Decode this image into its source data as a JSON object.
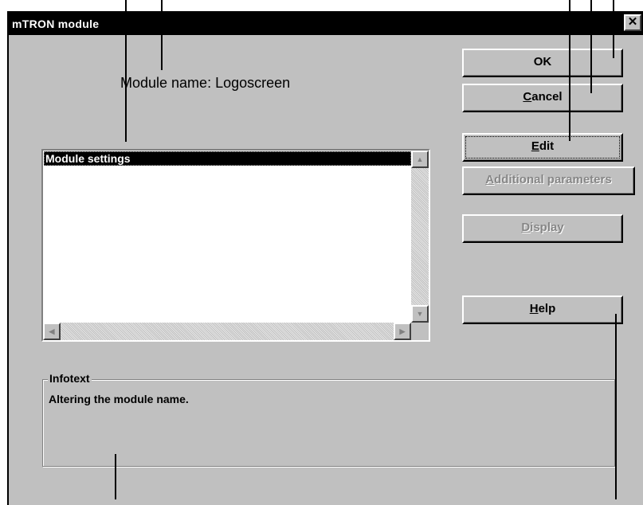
{
  "window": {
    "title": "mTRON module",
    "close_glyph": "✕"
  },
  "module_name": "Module name: Logoscreen",
  "buttons": {
    "ok": "OK",
    "cancel_mnemonic": "C",
    "cancel_rest": "ancel",
    "edit_mnemonic": "E",
    "edit_rest": "dit",
    "additional_mnemonic": "A",
    "additional_rest": "dditional parameters",
    "display_mnemonic": "D",
    "display_rest": "isplay",
    "help_mnemonic": "H",
    "help_rest": "elp"
  },
  "listbox": {
    "items": [
      "Module settings"
    ]
  },
  "scrollbar": {
    "up": "▲",
    "down": "▼",
    "left": "◀",
    "right": "▶"
  },
  "infotext": {
    "label": "Infotext",
    "text": "Altering the module name."
  },
  "colors": {
    "dialog_bg": "#c0c0c0",
    "titlebar": "#000000",
    "disabled_text": "#868686"
  }
}
